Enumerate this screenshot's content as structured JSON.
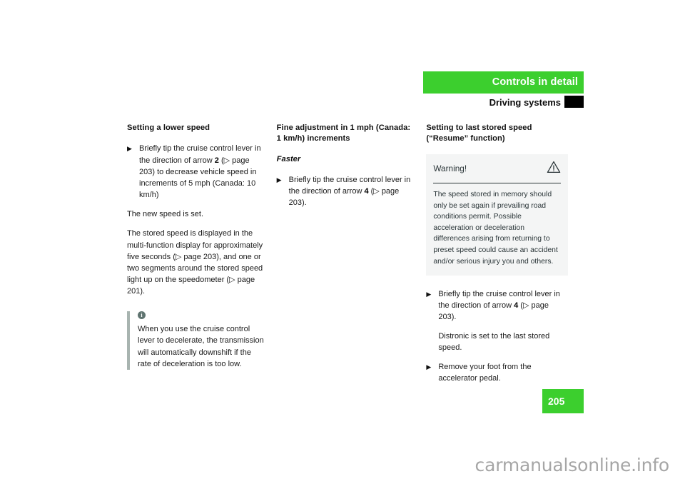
{
  "header": {
    "bar_title": "Controls in detail",
    "sub_title": "Driving systems"
  },
  "page_number": "205",
  "watermark": "carmanualsonline.info",
  "columns": [
    {
      "heading": "Setting a lower speed",
      "bullet1_text": "Briefly tip the cruise control lever in the direction of arrow ",
      "bullet1_num": "2",
      "bullet1_ref": " (▷ page 203) to decrease vehicle speed in increments of 5 mph (Canada: 10 km/h)",
      "para1": "The new speed is set.",
      "para2": "The stored speed is displayed in the multi-function display for approximately five seconds (▷ page 203), and one or two segments around the stored speed light up on the speedometer (▷ page 201).",
      "note_icon": "info-icon",
      "note_text": "When you use the cruise control lever to decelerate, the transmission will automatically downshift if the rate of deceleration is too low."
    },
    {
      "heading": "Fine adjustment in 1 mph (Canada: 1 km/h) increments",
      "subheading": "Faster",
      "bullet1_text": "Briefly tip the cruise control lever in the direction of arrow ",
      "bullet1_num": "4",
      "bullet1_ref": " (▷ page 203)."
    },
    {
      "heading": "Setting to last stored speed (“Resume” function)",
      "warning": {
        "title": "Warning!",
        "icon": "warning-triangle-icon",
        "text": "The speed stored in memory should only be set again if prevailing road conditions permit. Possible acceleration or deceleration differences arising from returning to preset speed could cause an accident and/or serious injury you and others."
      },
      "bullet1_text": "Briefly tip the cruise control lever in the direction of arrow ",
      "bullet1_num": "4",
      "bullet1_ref": " (▷ page 203).",
      "bullet1_sub": "Distronic is set to the last stored speed.",
      "bullet2_text": "Remove your foot from the accelerator pedal."
    }
  ],
  "colors": {
    "brand_green": "#3ccf2e",
    "note_rule": "#a8b4b0",
    "warning_bg": "#f4f5f5",
    "warning_fg": "#2a3538"
  }
}
